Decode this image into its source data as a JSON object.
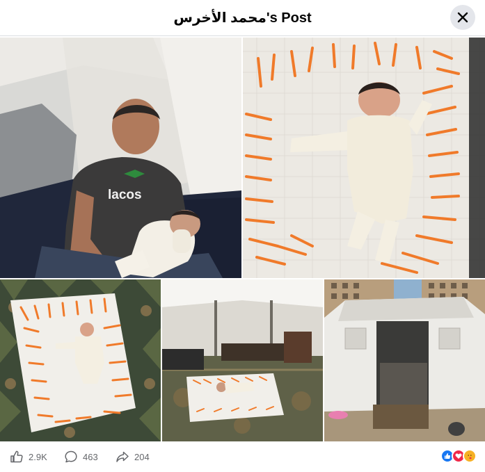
{
  "post": {
    "title": "محمد الأخرس's Post"
  },
  "icons": {
    "close": "close-icon",
    "like": "like-icon",
    "comment": "comment-icon",
    "share": "share-icon",
    "reaction_like": "like-reaction-icon",
    "reaction_love": "love-reaction-icon",
    "reaction_care": "care-reaction-icon"
  },
  "stats": {
    "likes": "2.9K",
    "comments": "463",
    "shares": "204"
  },
  "colors": {
    "accent": "#1877f2",
    "love": "#f02849",
    "care": "#f7b125",
    "muted_text": "#65676b"
  }
}
